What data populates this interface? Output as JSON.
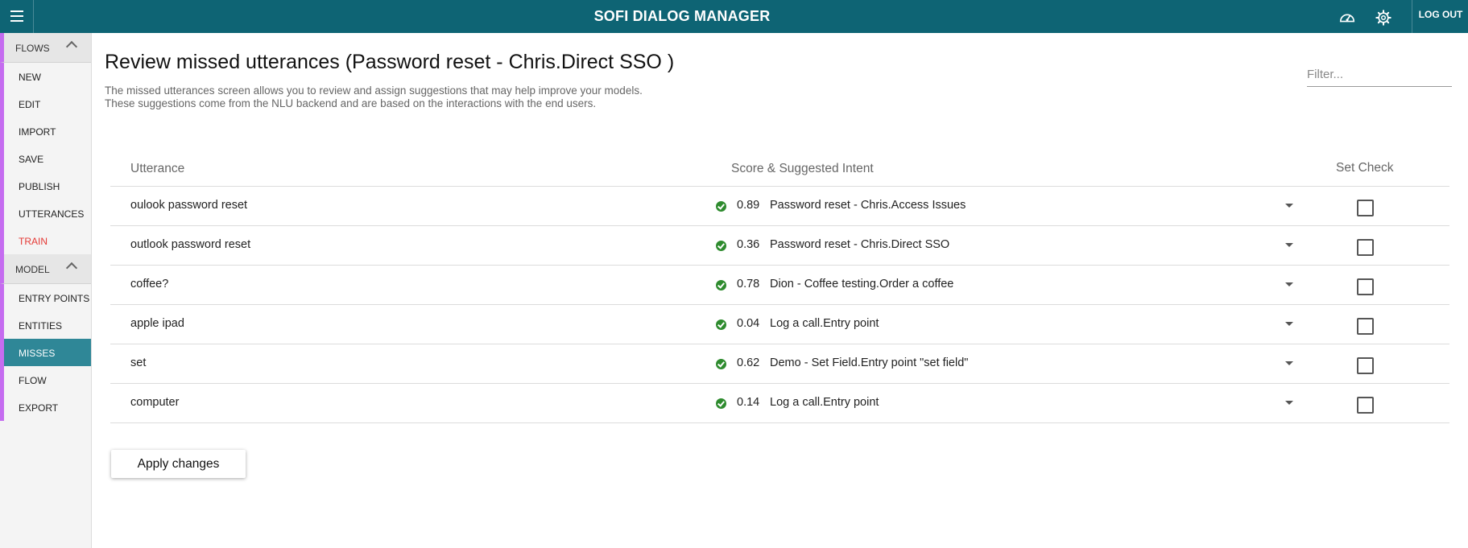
{
  "header": {
    "title": "SOFI DIALOG MANAGER",
    "logout_label": "LOG OUT",
    "icons": [
      "menu-icon",
      "dashboard-icon",
      "gear-icon"
    ],
    "background": "#0e6474"
  },
  "sidebar": {
    "sections": [
      {
        "label": "FLOWS",
        "items": [
          {
            "label": "NEW"
          },
          {
            "label": "EDIT"
          },
          {
            "label": "IMPORT"
          },
          {
            "label": "SAVE"
          },
          {
            "label": "PUBLISH"
          },
          {
            "label": "UTTERANCES"
          },
          {
            "label": "TRAIN",
            "color": "#e53935"
          }
        ]
      },
      {
        "label": "MODEL",
        "items": [
          {
            "label": "ENTRY POINTS"
          },
          {
            "label": "ENTITIES"
          },
          {
            "label": "MISSES",
            "active": true
          },
          {
            "label": "FLOW"
          },
          {
            "label": "EXPORT"
          }
        ]
      }
    ],
    "accent_color": "#c56cf0",
    "active_color": "#2f8797"
  },
  "main": {
    "title": "Review missed utterances (Password reset - Chris.Direct SSO )",
    "description_line1": "The missed utterances screen allows you to review and assign suggestions that may help improve your models.",
    "description_line2": "These suggestions come from the NLU backend and are based on the interactions with the end users.",
    "filter_placeholder": "Filter...",
    "table": {
      "headers": {
        "utterance": "Utterance",
        "score_intent": "Score & Suggested Intent",
        "set_check": "Set Check"
      },
      "rows": [
        {
          "utterance": "oulook password reset",
          "score": "0.89",
          "intent": "Password reset - Chris.Access Issues",
          "checked": false
        },
        {
          "utterance": "outlook password reset",
          "score": "0.36",
          "intent": "Password reset - Chris.Direct SSO",
          "checked": false
        },
        {
          "utterance": "coffee?",
          "score": "0.78",
          "intent": "Dion - Coffee testing.Order a coffee",
          "checked": false
        },
        {
          "utterance": "apple ipad",
          "score": "0.04",
          "intent": "Log a call.Entry point",
          "checked": false
        },
        {
          "utterance": "set",
          "score": "0.62",
          "intent": "Demo - Set Field.Entry point \"set field\"",
          "checked": false
        },
        {
          "utterance": "computer",
          "score": "0.14",
          "intent": "Log a call.Entry point",
          "checked": false
        }
      ]
    },
    "apply_label": "Apply changes"
  }
}
